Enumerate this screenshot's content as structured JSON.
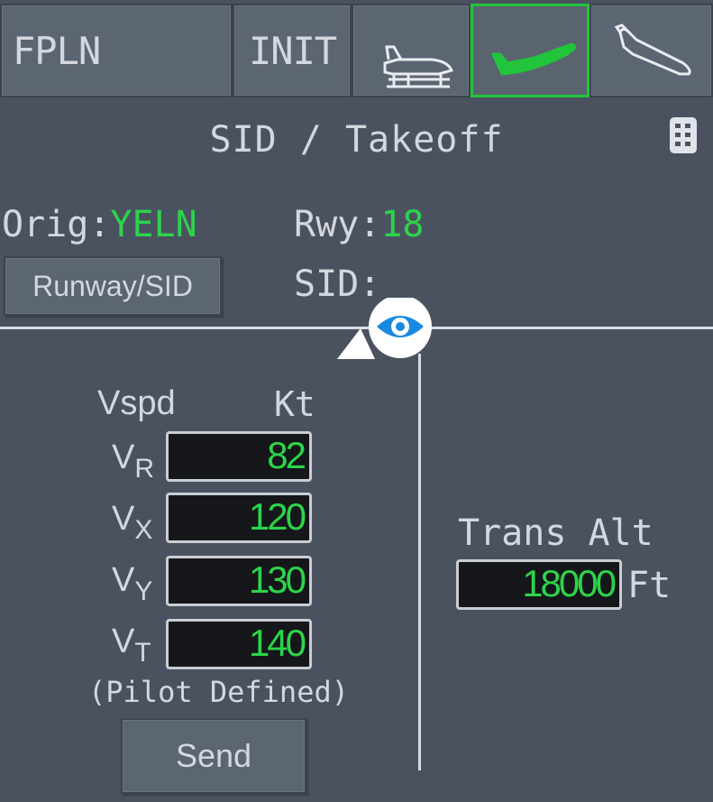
{
  "tabs": {
    "fpln": "FPLN",
    "init": "INIT",
    "ground_icon": "aircraft-on-ground-icon",
    "takeoff_icon": "takeoff-icon",
    "climb_icon": "climb-icon"
  },
  "page": {
    "title": "SID / Takeoff",
    "pages_icon": "page-list-icon"
  },
  "origin": {
    "label": "Orig:",
    "value": "YELN"
  },
  "runway": {
    "label": "Rwy:",
    "value": "18"
  },
  "sid": {
    "label": "SID:",
    "value": ""
  },
  "runway_sid_button": "Runway/SID",
  "eye_icon": "eye-icon",
  "vspeeds": {
    "header_left": "Vspd",
    "header_right": "Kt",
    "vr": {
      "main": "V",
      "sub": "R",
      "value": "82"
    },
    "vx": {
      "main": "V",
      "sub": "X",
      "value": "120"
    },
    "vy": {
      "main": "V",
      "sub": "Y",
      "value": "130"
    },
    "vt": {
      "main": "V",
      "sub": "T",
      "value": "140"
    },
    "note": "(Pilot Defined)"
  },
  "send_button": "Send",
  "trans_alt": {
    "label": "Trans Alt",
    "value": "18000",
    "unit": "Ft"
  },
  "colors": {
    "active_green": "#21c43a",
    "value_green": "#2cd44a",
    "background": "#4a5260"
  }
}
